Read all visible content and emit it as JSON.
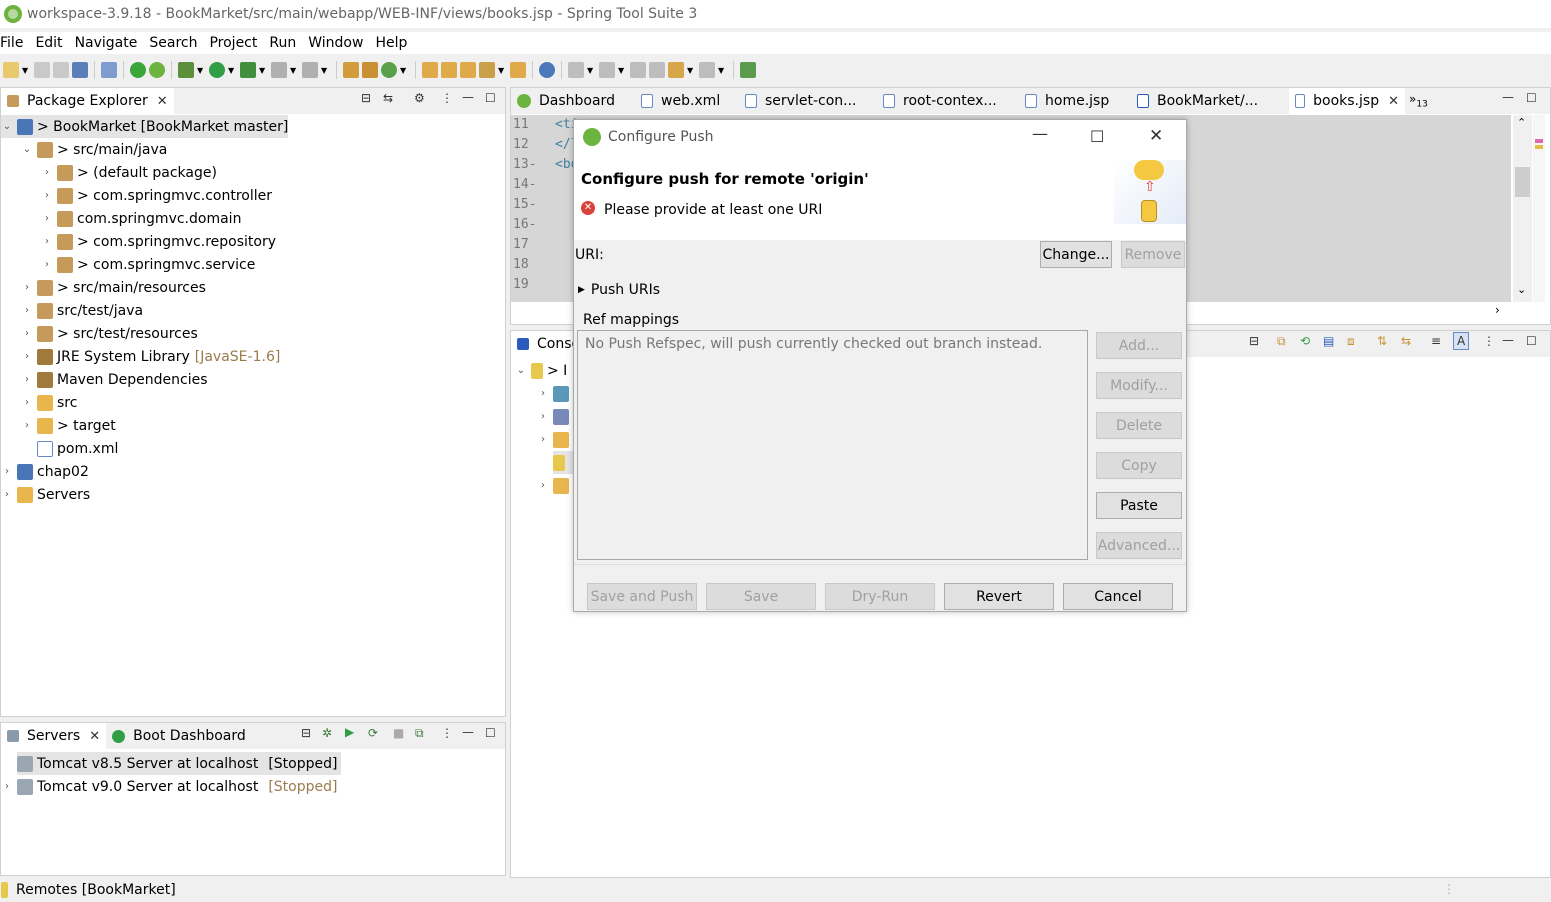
{
  "window": {
    "title": "workspace-3.9.18 - BookMarket/src/main/webapp/WEB-INF/views/books.jsp - Spring Tool Suite 3"
  },
  "menu": [
    "File",
    "Edit",
    "Navigate",
    "Search",
    "Project",
    "Run",
    "Window",
    "Help"
  ],
  "package_explorer": {
    "tab_label": "Package Explorer",
    "tree": [
      {
        "label": "> BookMarket [BookMarket master]",
        "level": 0,
        "expanded": true,
        "icon": "project-icon",
        "selected": true
      },
      {
        "label": "> src/main/java",
        "level": 1,
        "expanded": true,
        "icon": "source-folder-icon"
      },
      {
        "label": "> (default package)",
        "level": 2,
        "expanded": false,
        "icon": "package-icon"
      },
      {
        "label": "> com.springmvc.controller",
        "level": 2,
        "expanded": false,
        "icon": "package-icon"
      },
      {
        "label": "com.springmvc.domain",
        "level": 2,
        "expanded": false,
        "icon": "package-icon"
      },
      {
        "label": "> com.springmvc.repository",
        "level": 2,
        "expanded": false,
        "icon": "package-icon"
      },
      {
        "label": "> com.springmvc.service",
        "level": 2,
        "expanded": false,
        "icon": "package-icon"
      },
      {
        "label": "> src/main/resources",
        "level": 1,
        "expanded": false,
        "icon": "source-folder-icon"
      },
      {
        "label": "src/test/java",
        "level": 1,
        "expanded": false,
        "icon": "source-folder-icon"
      },
      {
        "label": "> src/test/resources",
        "level": 1,
        "expanded": false,
        "icon": "source-folder-icon"
      },
      {
        "label": "JRE System Library",
        "decoration": "[JavaSE-1.6]",
        "level": 1,
        "expanded": false,
        "icon": "library-icon"
      },
      {
        "label": "Maven Dependencies",
        "level": 1,
        "expanded": false,
        "icon": "library-icon"
      },
      {
        "label": "src",
        "level": 1,
        "expanded": false,
        "icon": "folder-icon"
      },
      {
        "label": "> target",
        "level": 1,
        "expanded": false,
        "icon": "folder-icon"
      },
      {
        "label": "pom.xml",
        "level": 1,
        "leaf": true,
        "icon": "xml-file-icon"
      },
      {
        "label": "chap02",
        "level": 0,
        "expanded": false,
        "icon": "project-icon"
      },
      {
        "label": "Servers",
        "level": 0,
        "expanded": false,
        "icon": "folder-icon"
      }
    ]
  },
  "editor": {
    "tabs": [
      "Dashboard",
      "web.xml",
      "servlet-con...",
      "root-contex...",
      "home.jsp",
      "BookMarket/...",
      "books.jsp"
    ],
    "active_tab": "books.jsp",
    "overflow_count": "13",
    "lines": [
      {
        "no": "11",
        "code": "<ti"
      },
      {
        "no": "12",
        "code": "</l"
      },
      {
        "no": "13-",
        "code": "<bo"
      },
      {
        "no": "14-",
        "code": ""
      },
      {
        "no": "15-",
        "code": ""
      },
      {
        "no": "16-",
        "code": ""
      },
      {
        "no": "17",
        "code": ""
      },
      {
        "no": "18",
        "code": ""
      },
      {
        "no": "19",
        "code": ""
      }
    ]
  },
  "console": {
    "tab_label": "Consc",
    "first_row_label": "> I"
  },
  "servers_panel": {
    "tabs": [
      "Servers",
      "Boot Dashboard"
    ],
    "servers": [
      {
        "label": "Tomcat v8.5 Server at localhost",
        "state": "[Stopped]",
        "selected": true
      },
      {
        "label": "Tomcat v9.0 Server at localhost",
        "state": "[Stopped]",
        "selected": false
      }
    ]
  },
  "dialog": {
    "window_title": "Configure Push",
    "heading": "Configure push for remote 'origin'",
    "error_message": "Please provide at least one URI",
    "uri_label": "URI:",
    "change_button": "Change...",
    "remove_button": "Remove",
    "push_uris_label": "Push URIs",
    "ref_mappings_label": "Ref mappings",
    "refspec_placeholder": "No Push Refspec, will push currently checked out branch instead.",
    "side_buttons": [
      {
        "label": "Add...",
        "enabled": false
      },
      {
        "label": "Modify...",
        "enabled": false
      },
      {
        "label": "Delete",
        "enabled": false
      },
      {
        "label": "Copy",
        "enabled": false
      },
      {
        "label": "Paste",
        "enabled": true
      },
      {
        "label": "Advanced...",
        "enabled": false
      }
    ],
    "bottom_buttons": [
      {
        "label": "Save and Push",
        "enabled": false
      },
      {
        "label": "Save",
        "enabled": false
      },
      {
        "label": "Dry-Run",
        "enabled": false
      },
      {
        "label": "Revert",
        "enabled": true
      },
      {
        "label": "Cancel",
        "enabled": true
      }
    ]
  },
  "status_bar": {
    "text": "Remotes [BookMarket]"
  },
  "colors": {
    "spring_green": "#6db33f",
    "error_red": "#d9423a",
    "decoration_brown": "#9a7c4c"
  }
}
